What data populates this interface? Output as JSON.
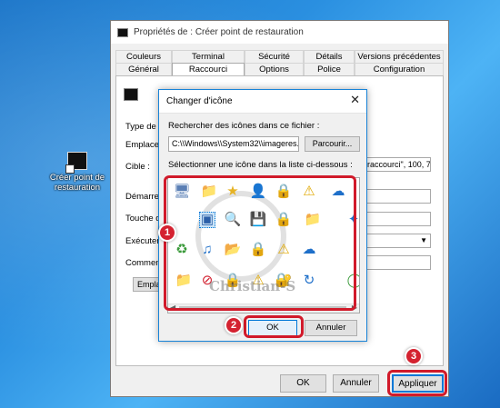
{
  "desktop": {
    "shortcut_label": "Créer point de restauration"
  },
  "window": {
    "title": "Propriétés de : Créer point de restauration",
    "tabs_row1": [
      "Couleurs",
      "Terminal",
      "Sécurité",
      "Détails",
      "Versions précédentes"
    ],
    "tabs_row2": [
      "Général",
      "Raccourci",
      "Options",
      "Police",
      "Configuration"
    ],
    "selected_tab": "Raccourci",
    "labels": {
      "type": "Type de c",
      "location": "Emplacem",
      "target": "Cible :",
      "start_in": "Démarrer",
      "shortcut_key": "Touche d",
      "run": "Exécuter",
      "comment": "Commenta"
    },
    "target_value_tail": "raccourci\", 100, 7\"",
    "location_button": "Emplac",
    "buttons": {
      "ok": "OK",
      "cancel": "Annuler",
      "apply": "Appliquer"
    }
  },
  "dialog": {
    "title": "Changer d'icône",
    "search_label": "Rechercher des icônes dans ce fichier :",
    "file_path": "C:\\\\Windows\\\\System32\\\\imageres.c",
    "browse_button": "Parcourir...",
    "select_label": "Sélectionner une icône dans la liste ci-dessous :",
    "watermark": "Christian-S",
    "ok_button": "OK",
    "cancel_button": "Annuler"
  },
  "annotations": {
    "badge_1": "1",
    "badge_2": "2",
    "badge_3": "3",
    "accent_color": "#d11a2a"
  }
}
